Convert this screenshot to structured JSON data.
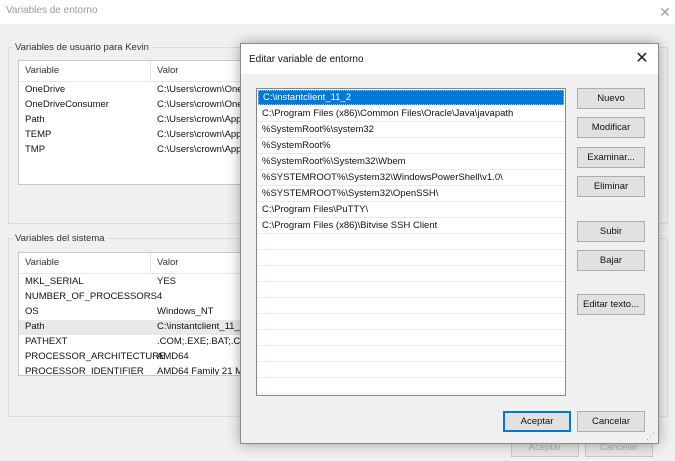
{
  "bg": {
    "window_title": "Variables de entorno",
    "close_glyph": "✕",
    "user_group_label": "Variables de usuario para Kevin",
    "user_columns": [
      "Variable",
      "Valor"
    ],
    "user_rows": [
      {
        "name": "OneDrive",
        "value": "C:\\Users\\crown\\One"
      },
      {
        "name": "OneDriveConsumer",
        "value": "C:\\Users\\crown\\One"
      },
      {
        "name": "Path",
        "value": "C:\\Users\\crown\\App"
      },
      {
        "name": "TEMP",
        "value": "C:\\Users\\crown\\App"
      },
      {
        "name": "TMP",
        "value": "C:\\Users\\crown\\App"
      }
    ],
    "system_group_label": "Variables del sistema",
    "system_columns": [
      "Variable",
      "Valor"
    ],
    "system_rows": [
      {
        "name": "MKL_SERIAL",
        "value": "YES"
      },
      {
        "name": "NUMBER_OF_PROCESSORS",
        "value": "4"
      },
      {
        "name": "OS",
        "value": "Windows_NT"
      },
      {
        "name": "Path",
        "value": "C:\\instantclient_11_2"
      },
      {
        "name": "PATHEXT",
        "value": ".COM;.EXE;.BAT;.CM"
      },
      {
        "name": "PROCESSOR_ARCHITECTURE",
        "value": "AMD64"
      },
      {
        "name": "PROCESSOR_IDENTIFIER",
        "value": "AMD64 Family 21 M"
      }
    ],
    "selected_system_row": 3,
    "footer_buttons": [
      "Aceptar",
      "Cancelar"
    ]
  },
  "dialog": {
    "title": "Editar variable de entorno",
    "close_glyph": "✕",
    "paths": [
      "C:\\instantclient_11_2",
      "C:\\Program Files (x86)\\Common Files\\Oracle\\Java\\javapath",
      "%SystemRoot%\\system32",
      "%SystemRoot%",
      "%SystemRoot%\\System32\\Wbem",
      "%SYSTEMROOT%\\System32\\WindowsPowerShell\\v1.0\\",
      "%SYSTEMROOT%\\System32\\OpenSSH\\",
      "C:\\Program Files\\PuTTY\\",
      "C:\\Program Files (x86)\\Bitvise SSH Client"
    ],
    "selected_index": 0,
    "buttons": {
      "new": "Nuevo",
      "edit": "Modificar",
      "browse": "Examinar...",
      "delete": "Eliminar",
      "up": "Subir",
      "down": "Bajar",
      "edit_text": "Editar texto..."
    },
    "ok": "Aceptar",
    "cancel": "Cancelar",
    "grip_glyph": "⋰"
  },
  "colors": {
    "accent": "#0078d7",
    "window_bg": "#f0f0f0"
  }
}
